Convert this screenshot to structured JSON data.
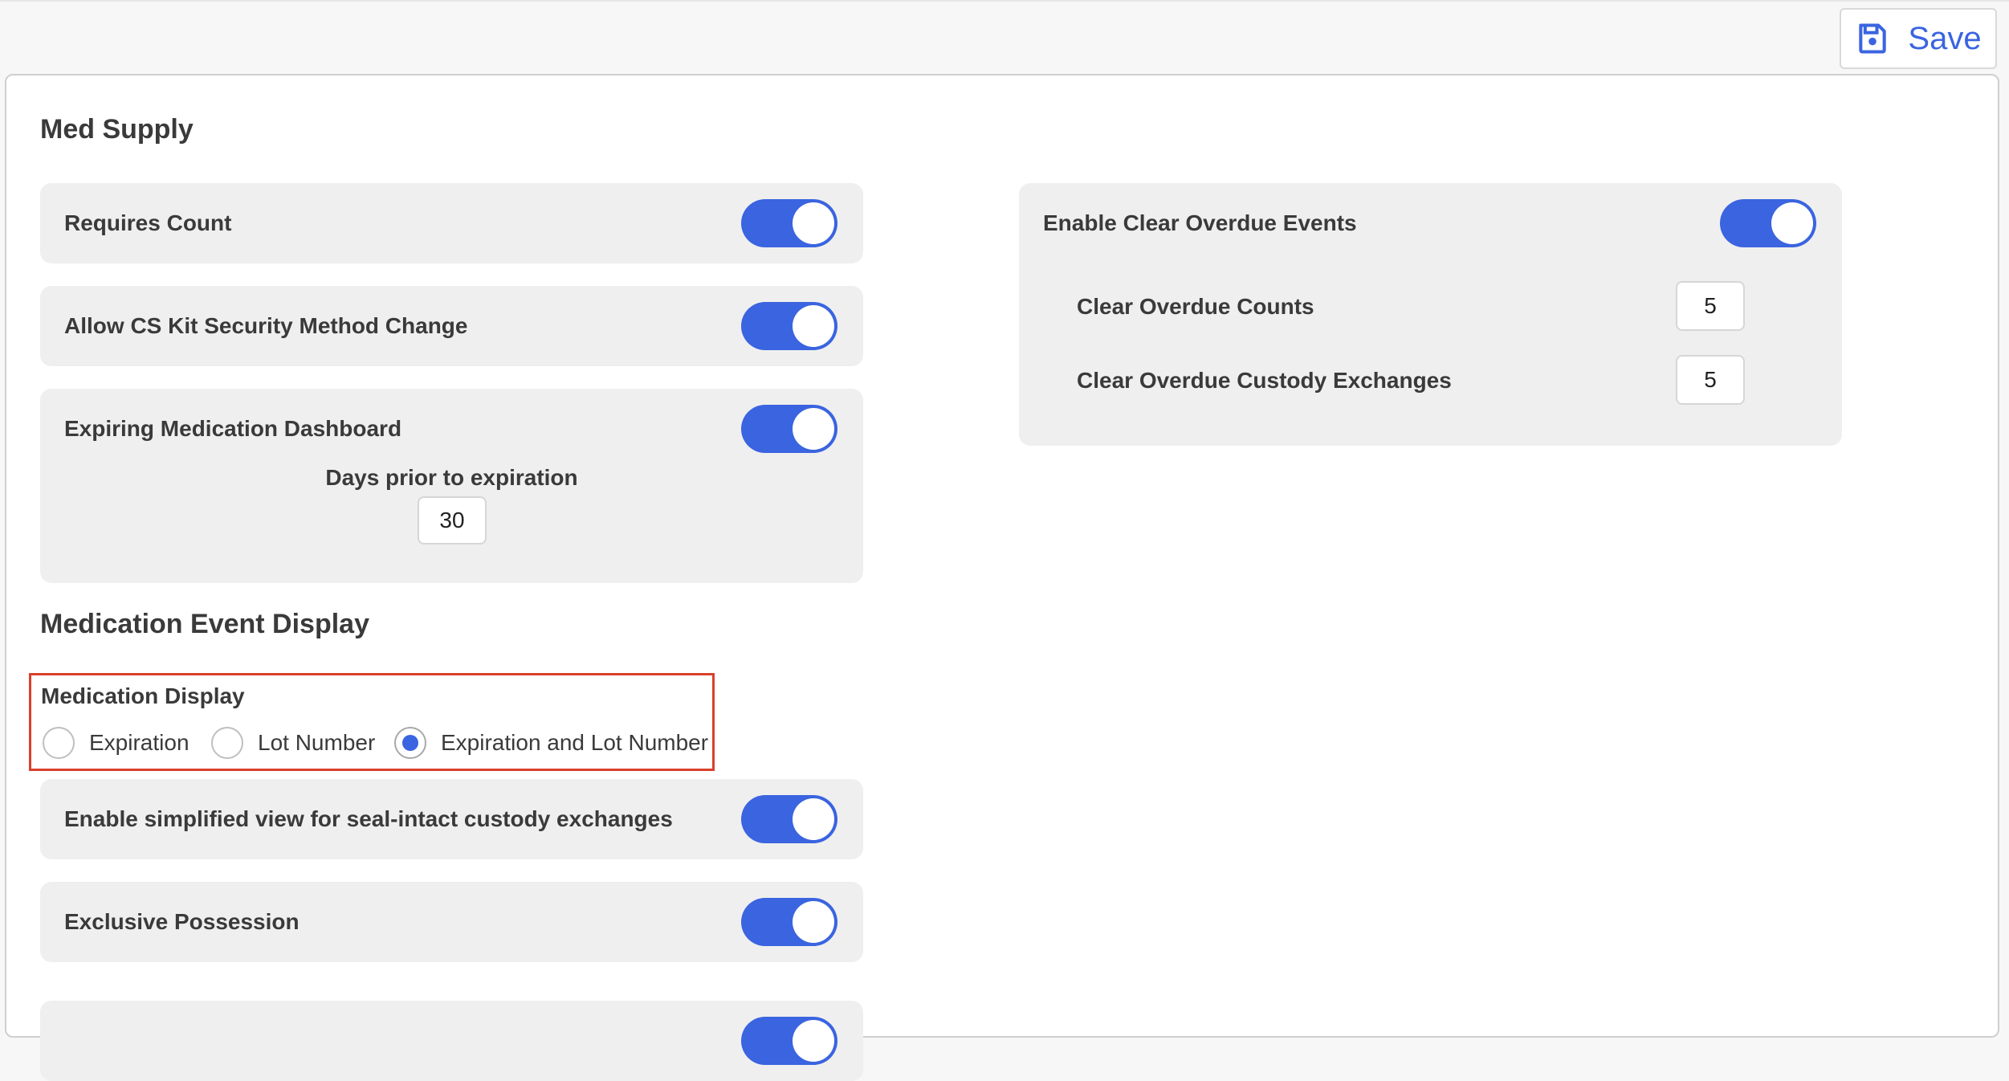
{
  "toolbar": {
    "save_label": "Save",
    "save_icon": "floppy-disk-icon",
    "accent_color": "#3a64e0"
  },
  "med_supply": {
    "title": "Med Supply",
    "requires_count": {
      "label": "Requires Count",
      "enabled": true
    },
    "allow_cs_kit": {
      "label": "Allow CS Kit Security Method Change",
      "enabled": true
    },
    "expiring_dashboard": {
      "label": "Expiring Medication Dashboard",
      "enabled": true,
      "days_label": "Days prior to expiration",
      "days_value": "30"
    },
    "clear_overdue": {
      "label": "Enable Clear Overdue Events",
      "enabled": true,
      "counts_label": "Clear Overdue Counts",
      "counts_value": "5",
      "custody_label": "Clear Overdue Custody Exchanges",
      "custody_value": "5"
    }
  },
  "med_event_display": {
    "title": "Medication Event Display",
    "display_group": {
      "label": "Medication Display",
      "options": [
        "Expiration",
        "Lot Number",
        "Expiration and Lot Number"
      ],
      "selected": "Expiration and Lot Number"
    },
    "simplified_view": {
      "label": "Enable simplified view for seal-intact custody exchanges",
      "enabled": true
    },
    "exclusive_possession": {
      "label": "Exclusive Possession",
      "enabled": true
    }
  }
}
